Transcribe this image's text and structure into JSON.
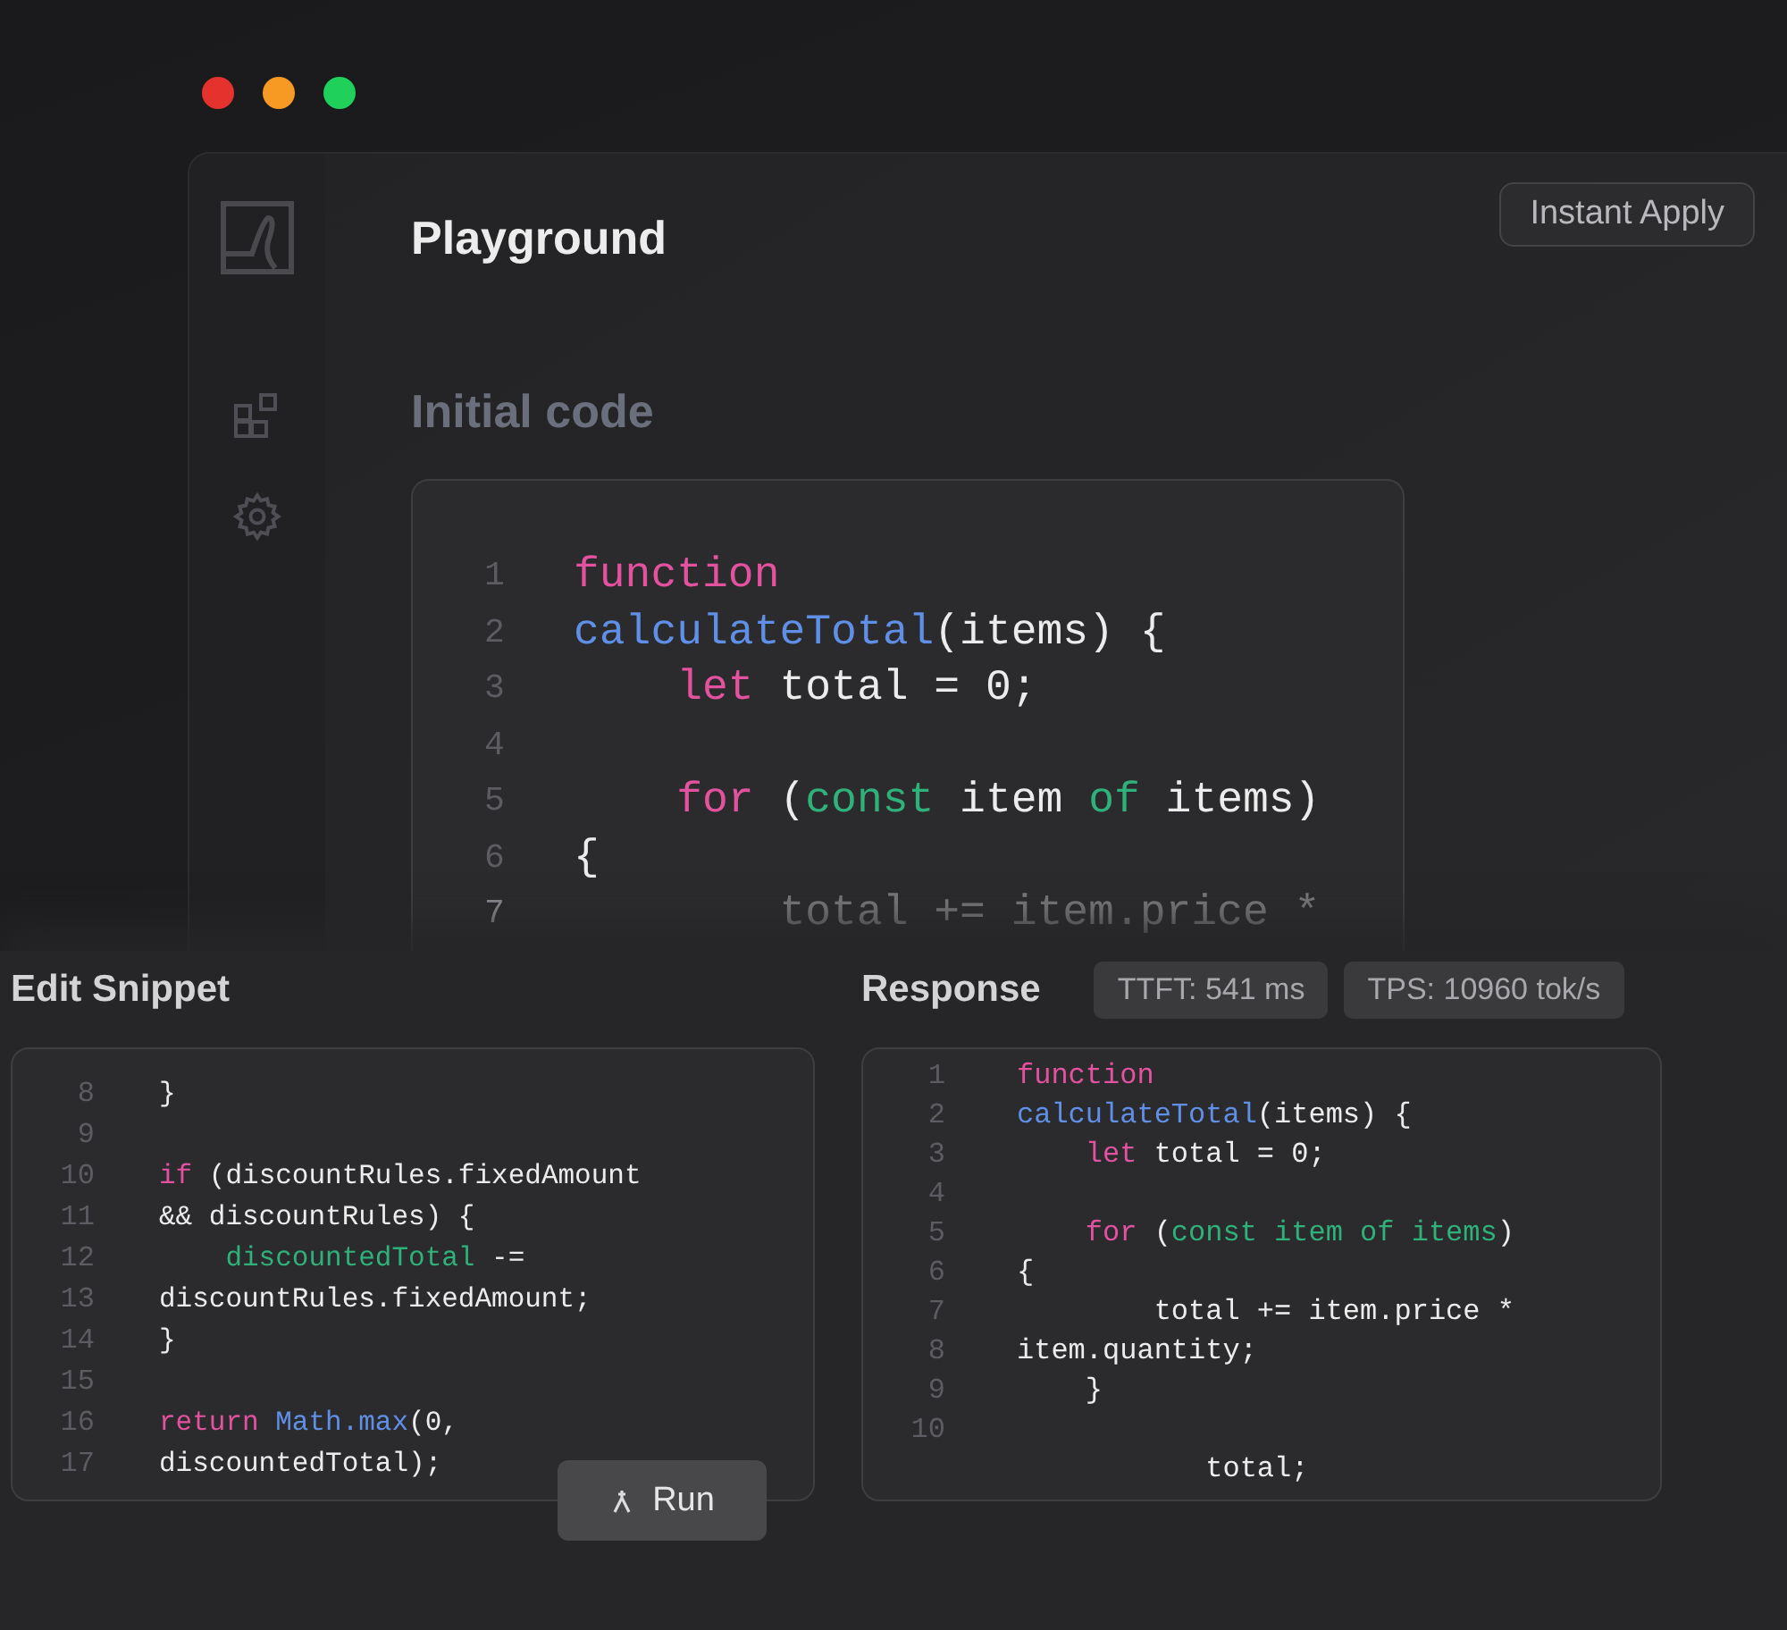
{
  "window": {
    "title": "Playground",
    "controls": [
      {
        "color": "#e5322d"
      },
      {
        "color": "#f79a24"
      },
      {
        "color": "#1fd15a"
      }
    ]
  },
  "header": {
    "button": "Instant Apply"
  },
  "initial_code": {
    "heading": "Initial code",
    "lines": [
      {
        "number": "1",
        "tokens": [
          {
            "text": "function",
            "kind": "keyword"
          }
        ]
      },
      {
        "number": "2",
        "tokens": [
          {
            "text": "calculateTotal",
            "kind": "function"
          },
          {
            "text": "(items) {",
            "kind": "plain"
          }
        ]
      },
      {
        "number": "3",
        "tokens": [
          {
            "text": "    let",
            "kind": "keyword"
          },
          {
            "text": " total = 0;",
            "kind": "plain"
          }
        ]
      },
      {
        "number": "4"
      },
      {
        "number": "5",
        "tokens": [
          {
            "text": "    for",
            "kind": "keyword"
          },
          {
            "text": " (",
            "kind": "plain"
          },
          {
            "text": "const",
            "kind": "binding"
          },
          {
            "text": " item ",
            "kind": "plain"
          },
          {
            "text": "of",
            "kind": "binding"
          },
          {
            "text": " items)",
            "kind": "plain"
          }
        ]
      },
      {
        "number": "6",
        "tokens": [
          {
            "text": "{",
            "kind": "plain"
          }
        ]
      },
      {
        "number": "7",
        "faded": true,
        "tokens": [
          {
            "text": "        total += item.price *",
            "kind": "plain"
          }
        ]
      }
    ]
  },
  "edit_snippet": {
    "heading": "Edit Snippet",
    "lines": [
      {
        "number": "8",
        "tokens": [
          {
            "text": "}",
            "kind": "plain"
          }
        ]
      },
      {
        "number": "9"
      },
      {
        "number": "10",
        "tokens": [
          {
            "text": "if",
            "kind": "keyword"
          },
          {
            "text": " (discountRules.fixedAmount",
            "kind": "plain"
          }
        ]
      },
      {
        "number": "11",
        "tokens": [
          {
            "text": "&& discountRules) {",
            "kind": "plain"
          }
        ]
      },
      {
        "number": "12",
        "tokens": [
          {
            "text": "    discountedTotal",
            "kind": "binding"
          },
          {
            "text": " -=",
            "kind": "plain"
          }
        ]
      },
      {
        "number": "13",
        "tokens": [
          {
            "text": "discountRules.fixedAmount;",
            "kind": "plain"
          }
        ]
      },
      {
        "number": "14",
        "tokens": [
          {
            "text": "}",
            "kind": "plain"
          }
        ]
      },
      {
        "number": "15"
      },
      {
        "number": "16",
        "tokens": [
          {
            "text": "return ",
            "kind": "keyword"
          },
          {
            "text": "Math.max",
            "kind": "function"
          },
          {
            "text": "(0,",
            "kind": "plain"
          }
        ]
      },
      {
        "number": "17",
        "tokens": [
          {
            "text": "discountedTotal);",
            "kind": "plain"
          }
        ]
      }
    ],
    "button": {
      "label": "Run"
    }
  },
  "response": {
    "heading": "Response",
    "badges": [
      "TTFT: 541 ms",
      "TPS: 10960 tok/s"
    ],
    "lines": [
      {
        "number": "1",
        "tokens": [
          {
            "text": "function",
            "kind": "keyword"
          }
        ]
      },
      {
        "number": "2",
        "tokens": [
          {
            "text": "calculateTotal",
            "kind": "function"
          },
          {
            "text": "(items) {",
            "kind": "plain"
          }
        ]
      },
      {
        "number": "3",
        "tokens": [
          {
            "text": "    let",
            "kind": "keyword"
          },
          {
            "text": " total = 0;",
            "kind": "plain"
          }
        ]
      },
      {
        "number": "4"
      },
      {
        "number": "5",
        "tokens": [
          {
            "text": "    for",
            "kind": "keyword"
          },
          {
            "text": " (",
            "kind": "plain"
          },
          {
            "text": "const item of items",
            "kind": "binding"
          },
          {
            "text": ")",
            "kind": "plain"
          }
        ]
      },
      {
        "number": "6",
        "tokens": [
          {
            "text": "{",
            "kind": "plain"
          }
        ]
      },
      {
        "number": "7",
        "tokens": [
          {
            "text": "        total += item.price *",
            "kind": "plain"
          }
        ]
      },
      {
        "number": "8",
        "tokens": [
          {
            "text": "item.quantity;",
            "kind": "plain"
          }
        ]
      },
      {
        "number": "9",
        "tokens": [
          {
            "text": "    }",
            "kind": "plain"
          }
        ]
      },
      {
        "number": "10"
      },
      {
        "tokens": [
          {
            "text": "           total;",
            "kind": "plain"
          }
        ]
      }
    ]
  }
}
